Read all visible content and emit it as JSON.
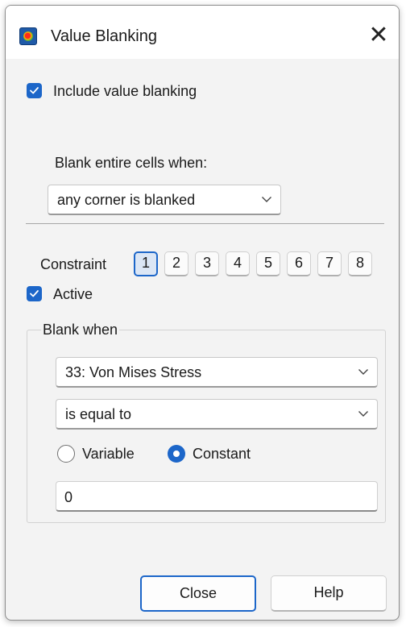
{
  "window": {
    "title": "Value Blanking",
    "close_glyph": "✕"
  },
  "include_value_blanking": {
    "label": "Include value blanking",
    "checked": true
  },
  "blank_entire_cells": {
    "label": "Blank entire cells when:",
    "selected": "any corner is blanked"
  },
  "constraint": {
    "label": "Constraint",
    "buttons": [
      "1",
      "2",
      "3",
      "4",
      "5",
      "6",
      "7",
      "8"
    ],
    "selected": "1"
  },
  "active": {
    "label": "Active",
    "checked": true
  },
  "blank_when": {
    "legend": "Blank when",
    "variable_select": "33: Von Mises Stress",
    "operator_select": "is equal to",
    "radio_variable_label": "Variable",
    "radio_constant_label": "Constant",
    "selected_radio": "Constant",
    "value": "0"
  },
  "buttons": {
    "close": "Close",
    "help": "Help"
  },
  "colors": {
    "accent": "#1c66c9",
    "window_bg": "#f3f3f3"
  },
  "icons": {
    "app": "app-logo-icon",
    "check": "checkmark-icon",
    "chevron": "chevron-down-icon"
  }
}
